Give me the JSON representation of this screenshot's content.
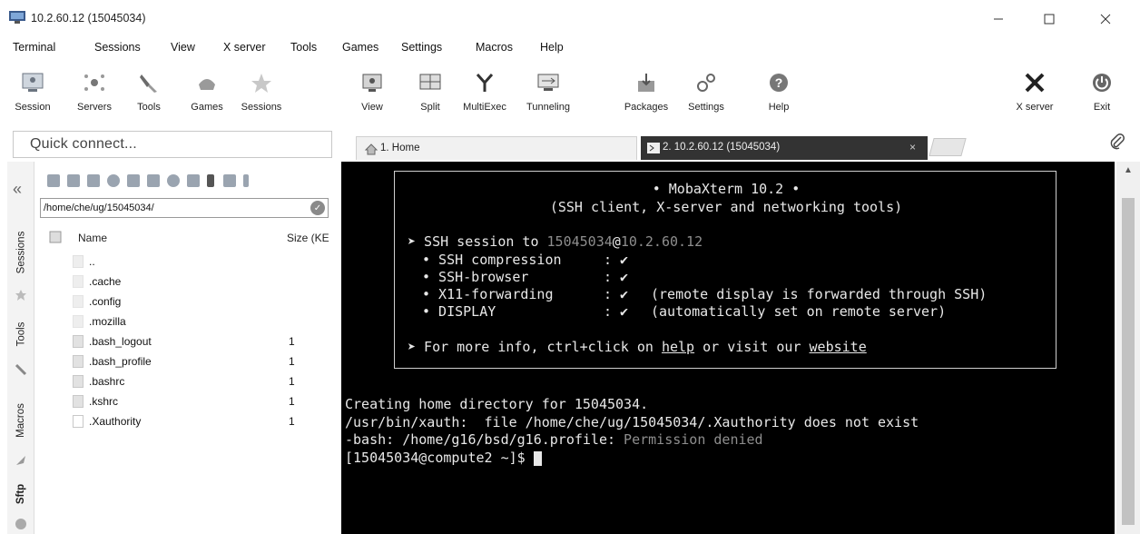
{
  "window": {
    "title": "10.2.60.12 (15045034)"
  },
  "menu": [
    "Terminal",
    "Sessions",
    "View",
    "X server",
    "Tools",
    "Games",
    "Settings",
    "Macros",
    "Help"
  ],
  "toolbar": {
    "buttons": [
      {
        "label": "Session",
        "icon": "session-icon"
      },
      {
        "label": "Servers",
        "icon": "servers-icon"
      },
      {
        "label": "Tools",
        "icon": "tools-icon"
      },
      {
        "label": "Games",
        "icon": "games-icon"
      },
      {
        "label": "Sessions",
        "icon": "star-icon"
      },
      {
        "label": "View",
        "icon": "view-icon"
      },
      {
        "label": "Split",
        "icon": "split-icon"
      },
      {
        "label": "MultiExec",
        "icon": "multiexec-icon"
      },
      {
        "label": "Tunneling",
        "icon": "tunneling-icon"
      },
      {
        "label": "Packages",
        "icon": "packages-icon"
      },
      {
        "label": "Settings",
        "icon": "settings-icon"
      },
      {
        "label": "Help",
        "icon": "help-icon"
      }
    ],
    "right": [
      {
        "label": "X server",
        "icon": "xserver-icon"
      },
      {
        "label": "Exit",
        "icon": "power-icon"
      }
    ]
  },
  "quick_connect": {
    "placeholder": "Quick connect..."
  },
  "tabs": [
    {
      "label": "1. Home"
    },
    {
      "label": "2. 10.2.60.12 (15045034)"
    }
  ],
  "sidebar": {
    "vtabs": [
      "Sessions",
      "Tools",
      "Macros",
      "Sftp"
    ]
  },
  "file_browser": {
    "path": "/home/che/ug/15045034/",
    "columns": {
      "name": "Name",
      "size": "Size (KE"
    },
    "files": [
      {
        "name": "..",
        "size": ""
      },
      {
        "name": ".cache",
        "size": ""
      },
      {
        "name": ".config",
        "size": ""
      },
      {
        "name": ".mozilla",
        "size": ""
      },
      {
        "name": ".bash_logout",
        "size": "1"
      },
      {
        "name": ".bash_profile",
        "size": "1"
      },
      {
        "name": ".bashrc",
        "size": "1"
      },
      {
        "name": ".kshrc",
        "size": "1"
      },
      {
        "name": ".Xauthority",
        "size": "1"
      }
    ]
  },
  "terminal": {
    "banner": {
      "title": "• MobaXterm 10.2 •",
      "subtitle": "(SSH client, X-server and networking tools)",
      "ssh_prefix": "➤ SSH session to ",
      "ssh_user": "15045034",
      "ssh_at": "@",
      "ssh_host": "10.2.60.12",
      "features": [
        {
          "name": "• SSH compression",
          "value": ": ✔",
          "note": ""
        },
        {
          "name": "• SSH-browser",
          "value": ": ✔",
          "note": ""
        },
        {
          "name": "• X11-forwarding",
          "value": ": ✔",
          "note": "(remote display is forwarded through SSH)"
        },
        {
          "name": "• DISPLAY",
          "value": ": ✔",
          "note": "(automatically set on remote server)"
        }
      ],
      "info_prefix": "➤ For more info, ctrl+click on ",
      "info_help": "help",
      "info_mid": " or visit our ",
      "info_website": "website"
    },
    "lines": [
      "Creating home directory for 15045034.",
      "/usr/bin/xauth:  file /home/che/ug/15045034/.Xauthority does not exist"
    ],
    "bash_prefix": "-bash: /home/g16/bsd/g16.profile: ",
    "bash_error": "Permission denied",
    "prompt": "[15045034@compute2 ~]$ "
  }
}
